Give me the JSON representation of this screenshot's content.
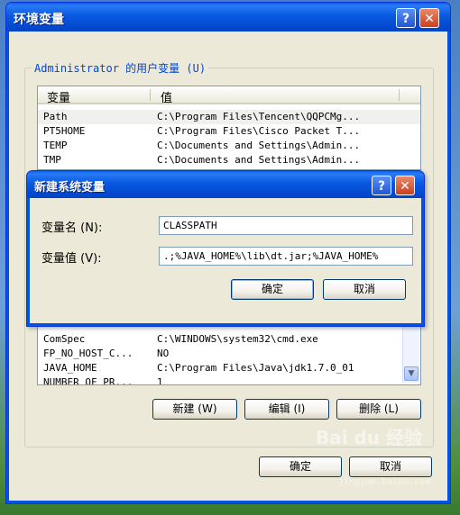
{
  "main": {
    "title": "环境变量",
    "user_group_label": "Administrator 的用户变量 (U)",
    "columns": [
      "变量",
      "值"
    ],
    "user_vars": [
      {
        "name": "Path",
        "value": "C:\\Program Files\\Tencent\\QQPCMg..."
      },
      {
        "name": "PT5HOME",
        "value": "C:\\Program Files\\Cisco Packet T..."
      },
      {
        "name": "TEMP",
        "value": "C:\\Documents and Settings\\Admin..."
      },
      {
        "name": "TMP",
        "value": "C:\\Documents and Settings\\Admin..."
      }
    ],
    "system_vars": [
      {
        "name": "ComSpec",
        "value": "C:\\WINDOWS\\system32\\cmd.exe"
      },
      {
        "name": "FP_NO_HOST_C...",
        "value": "NO"
      },
      {
        "name": "JAVA_HOME",
        "value": "C:\\Program Files\\Java\\jdk1.7.0_01"
      },
      {
        "name": "NUMBER_OF_PR...",
        "value": "1"
      }
    ],
    "new_button": "新建 (W)",
    "edit_button": "编辑 (I)",
    "delete_button": "删除 (L)",
    "ok_button": "确定",
    "cancel_button": "取消"
  },
  "dialog": {
    "title": "新建系统变量",
    "name_label": "变量名 (N):",
    "name_value": "CLASSPATH",
    "value_label": "变量值 (V):",
    "value_value": ".;%JAVA_HOME%\\lib\\dt.jar;%JAVA_HOME%",
    "ok_button": "确定",
    "cancel_button": "取消"
  },
  "titlebar_buttons": {
    "help": "?",
    "close": "✕"
  },
  "watermark": {
    "brand": "Bai du 经验",
    "url": "jingyan.baidu.com"
  },
  "colors": {
    "title_blue": "#0054e3",
    "legend_blue": "#0046d5",
    "face": "#ece9d8"
  }
}
